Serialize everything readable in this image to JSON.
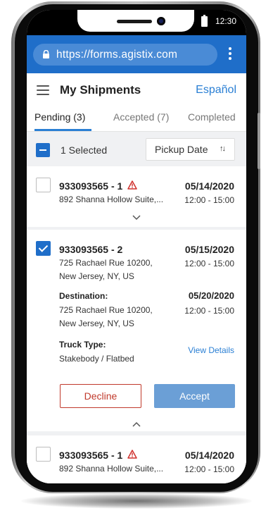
{
  "status_bar": {
    "time": "12:30"
  },
  "browser": {
    "url": "https://forms.agistix.com"
  },
  "header": {
    "title": "My Shipments",
    "language_link": "Español"
  },
  "tabs": [
    {
      "label": "Pending (3)",
      "active": true
    },
    {
      "label": "Accepted (7)",
      "active": false
    },
    {
      "label": "Completed",
      "active": false
    }
  ],
  "toolbar": {
    "selected_label": "1 Selected",
    "sort_label": "Pickup Date",
    "sort_icon": "↑↓"
  },
  "shipments": [
    {
      "id": "933093565 - 1",
      "warning": true,
      "checked": false,
      "pickup_date": "05/14/2020",
      "address": "892 Shanna Hollow Suite,...",
      "time": "12:00 - 15:00",
      "expanded": false
    },
    {
      "id": "933093565 - 2",
      "warning": false,
      "checked": true,
      "pickup_date": "05/15/2020",
      "address_line1": "725 Rachael Rue 10200,",
      "address_line2": "New Jersey, NY, US",
      "time": "12:00 - 15:00",
      "expanded": true,
      "destination_label": "Destination:",
      "destination_date": "05/20/2020",
      "destination_line1": "725 Rachael Rue 10200,",
      "destination_line2": "New Jersey, NY, US",
      "destination_time": "12:00 - 15:00",
      "truck_type_label": "Truck Type:",
      "truck_type": "Stakebody / Flatbed",
      "view_details": "View Details",
      "decline_label": "Decline",
      "accept_label": "Accept"
    },
    {
      "id": "933093565 - 1",
      "warning": true,
      "checked": false,
      "pickup_date": "05/14/2020",
      "address": "892 Shanna Hollow Suite,...",
      "time": "12:00 - 15:00",
      "expanded": false
    }
  ],
  "colors": {
    "brand_blue": "#1f6ec9",
    "link_blue": "#2a7fd4",
    "warning_red": "#d0312d",
    "decline_red": "#c0392b",
    "accept_blue": "#6b9fd6"
  },
  "icons": {
    "menu": "hamburger-icon",
    "lock": "lock-icon",
    "more": "kebab-menu-icon",
    "warning": "warning-triangle-icon",
    "expand": "chevron-down-icon",
    "collapse": "chevron-up-icon",
    "sort": "sort-arrows-icon"
  }
}
